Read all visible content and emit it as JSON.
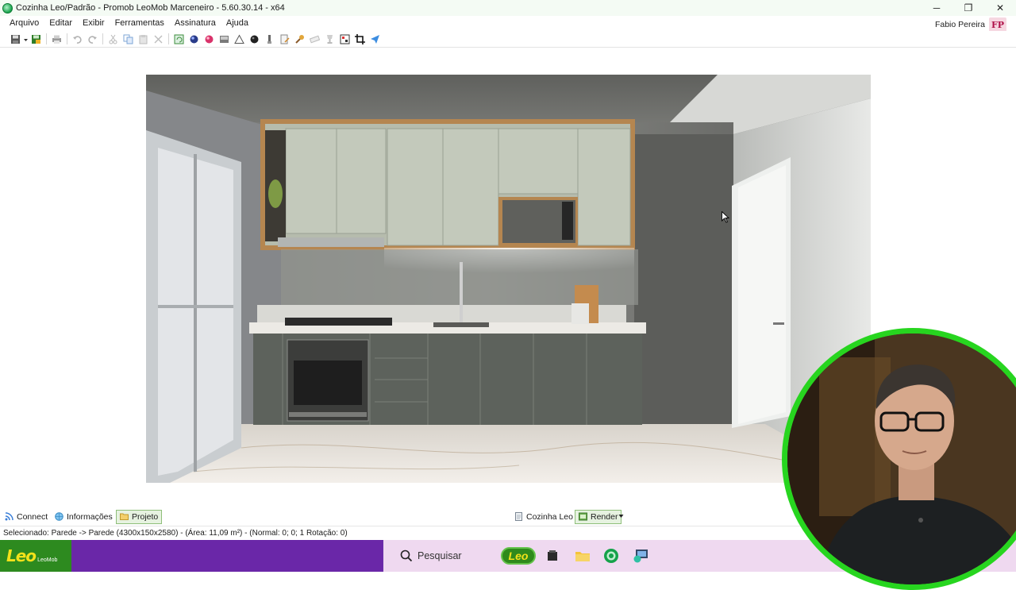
{
  "window": {
    "title": "Cozinha Leo/Padrão - Promob LeoMob Marceneiro - 5.60.30.14 - x64",
    "buttons": {
      "minimize": "─",
      "restore": "❐",
      "close": "✕"
    }
  },
  "menu": {
    "items": [
      "Arquivo",
      "Editar",
      "Exibir",
      "Ferramentas",
      "Assinatura",
      "Ajuda"
    ]
  },
  "user": {
    "name": "Fabio Pereira",
    "initials": "FP"
  },
  "toolbar": {
    "icons": [
      "save-icon",
      "save-as-icon",
      "print-icon",
      "undo-icon",
      "redo-icon",
      "cut-icon",
      "copy-icon",
      "paste-icon",
      "delete-icon",
      "refresh-icon",
      "sphere-icon",
      "color-icon",
      "image-icon",
      "triangle-icon",
      "black-sphere-icon",
      "light-icon",
      "note-icon",
      "paint-icon",
      "eraser-icon",
      "trophy-icon",
      "gallery-icon",
      "crop-icon",
      "send-icon"
    ]
  },
  "tabs": {
    "left": [
      {
        "label": "Connect",
        "icon": "rss-icon"
      },
      {
        "label": "Informações",
        "icon": "globe-icon"
      },
      {
        "label": "Projeto",
        "icon": "folder-icon"
      }
    ],
    "right": [
      {
        "label": "Cozinha Leo",
        "icon": "document-icon"
      },
      {
        "label": "Render",
        "icon": "render-icon"
      }
    ]
  },
  "status": {
    "text": "Selecionado: Parede -> Parede (4300x150x2580) - (Área: 11,09 m²) - (Normal: 0; 0; 1 Rotação: 0)"
  },
  "taskbar": {
    "brand": "Leo",
    "brand_sub": "LeoMob",
    "search_placeholder": "Pesquisar",
    "pinned_label": "Leo"
  },
  "colors": {
    "accent_green": "#27d51f",
    "taskbar_purple": "#6a27a8",
    "brand_yellow": "#f3e21a"
  }
}
